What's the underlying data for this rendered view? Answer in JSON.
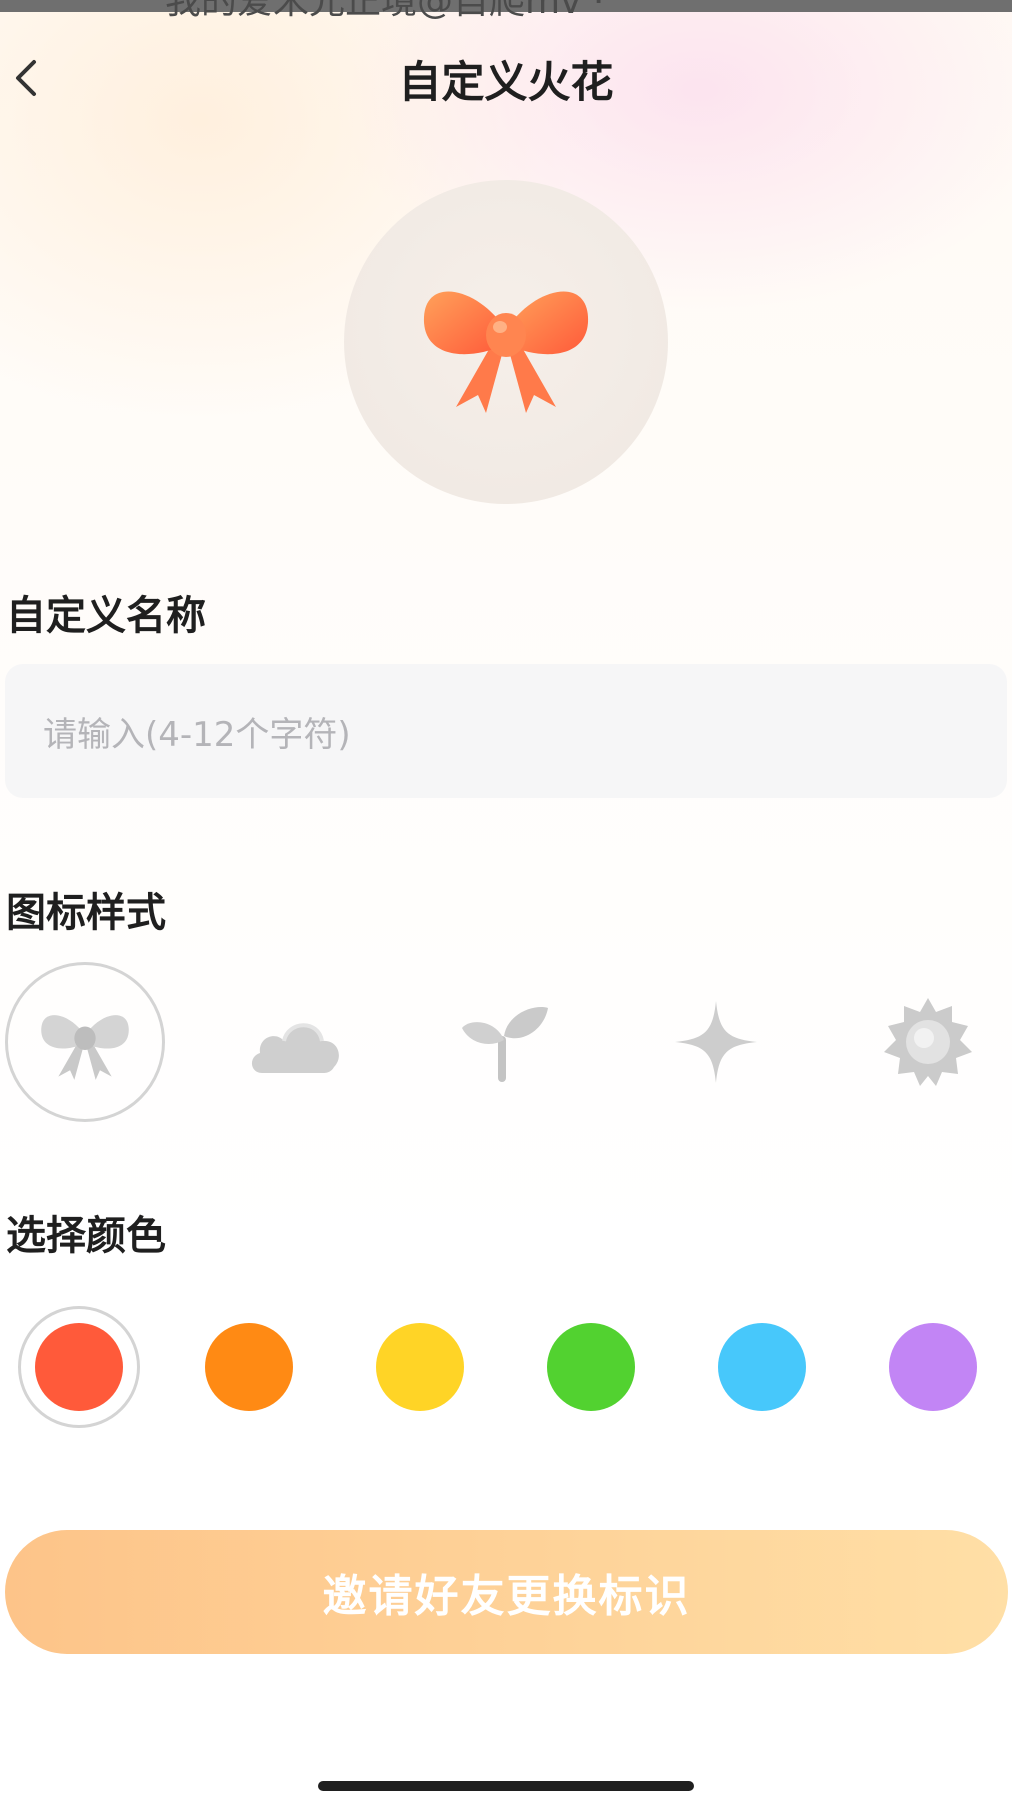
{
  "status": {
    "partial_text": "我的爱米兄正境@自爬mv ·"
  },
  "header": {
    "title": "自定义火花",
    "back_icon": "chevron-left-icon"
  },
  "preview": {
    "icon": "bow-icon",
    "color": "#ff6a3d"
  },
  "name_section": {
    "label": "自定义名称",
    "input_value": "",
    "input_placeholder": "请输入(4-12个字符)"
  },
  "icon_section": {
    "label": "图标样式",
    "options": [
      {
        "name": "bow-icon",
        "selected": true
      },
      {
        "name": "cloud-icon",
        "selected": false
      },
      {
        "name": "sprout-icon",
        "selected": false
      },
      {
        "name": "sparkle-icon",
        "selected": false
      },
      {
        "name": "sun-icon",
        "selected": false
      }
    ]
  },
  "color_section": {
    "label": "选择颜色",
    "colors": [
      {
        "hex": "#ff5a3a",
        "selected": true
      },
      {
        "hex": "#ff8a14",
        "selected": false
      },
      {
        "hex": "#ffd426",
        "selected": false
      },
      {
        "hex": "#52d230",
        "selected": false
      },
      {
        "hex": "#47c8fb",
        "selected": false
      },
      {
        "hex": "#c285f5",
        "selected": false
      }
    ]
  },
  "cta": {
    "label": "邀请好友更换标识"
  }
}
